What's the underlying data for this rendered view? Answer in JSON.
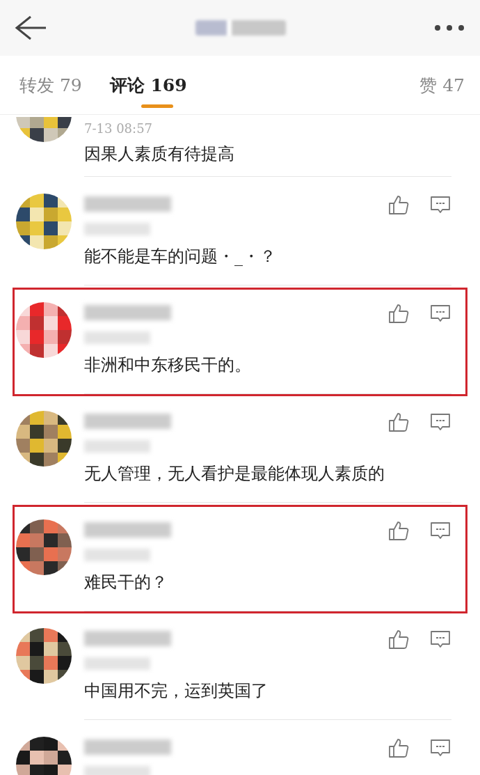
{
  "tabs": [
    {
      "label": "转发 79",
      "selected": false
    },
    {
      "label": "评论 169",
      "selected": true
    },
    {
      "label": "赞 47",
      "selected": false
    }
  ],
  "comments": [
    {
      "time": "7-13 08:57",
      "text": "因果人素质有待提高",
      "highlighted": false,
      "cut": true
    },
    {
      "text": "能不能是车的问题・_・？",
      "highlighted": false
    },
    {
      "text": "非洲和中东移民干的。",
      "highlighted": true
    },
    {
      "text": "无人管理，无人看护是最能体现人素质的",
      "highlighted": false
    },
    {
      "text": "难民干的？",
      "highlighted": true
    },
    {
      "text": "中国用不完，运到英国了",
      "highlighted": false
    },
    {
      "highlighted": false
    }
  ]
}
